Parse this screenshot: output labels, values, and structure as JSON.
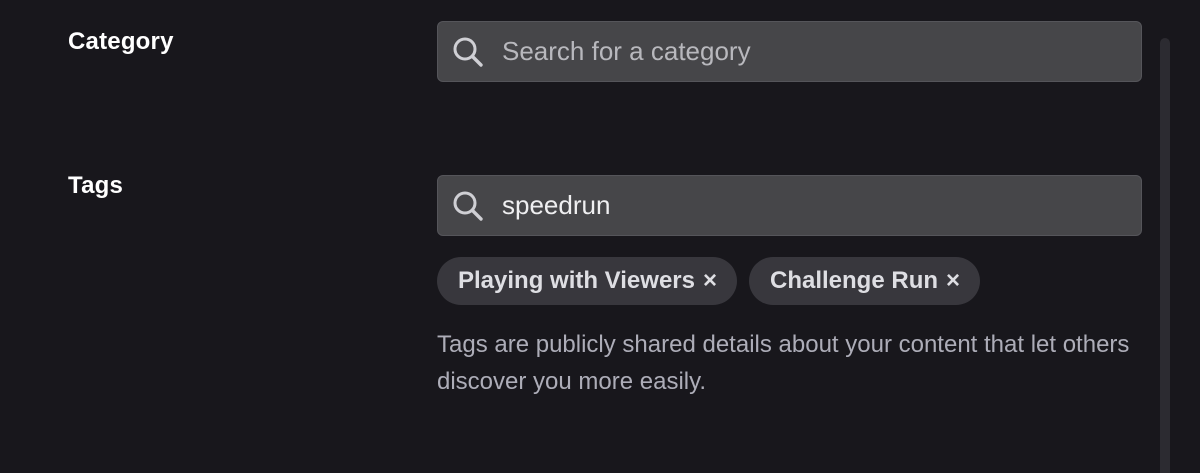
{
  "category": {
    "label": "Category",
    "search_placeholder": "Search for a category",
    "search_value": ""
  },
  "tags": {
    "label": "Tags",
    "search_value": "speedrun",
    "chips": [
      {
        "label": "Playing with Viewers",
        "remove": "×"
      },
      {
        "label": "Challenge Run",
        "remove": "×"
      }
    ],
    "helper_text": "Tags are publicly shared details about your content that let others discover you more easily."
  },
  "icons": {
    "search": "search-icon",
    "remove": "close-icon"
  },
  "colors": {
    "background": "#18171c",
    "field": "#464649",
    "chip": "#38373d",
    "label": "#ffffff",
    "helper": "#adadb8"
  }
}
